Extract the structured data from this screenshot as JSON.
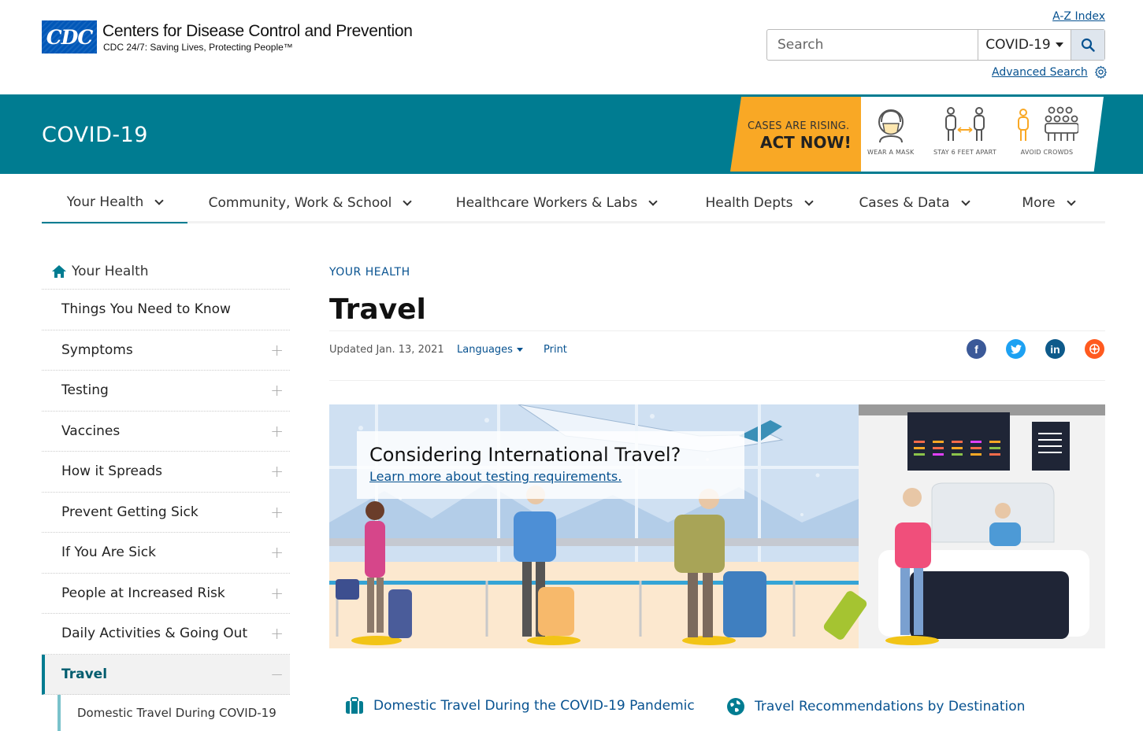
{
  "header": {
    "logo_text": "CDC",
    "org_name": "Centers for Disease Control and Prevention",
    "tagline": "CDC 24/7: Saving Lives, Protecting People™",
    "az_index": "A-Z Index",
    "search_placeholder": "Search",
    "search_scope": "COVID-19",
    "advanced_search": "Advanced Search"
  },
  "banner": {
    "title": "COVID-19",
    "promo_line1": "CASES ARE RISING.",
    "promo_line2": "ACT NOW!",
    "promo_items": [
      "WEAR A MASK",
      "STAY 6 FEET APART",
      "AVOID CROWDS"
    ]
  },
  "nav": {
    "items": [
      "Your Health",
      "Community, Work & School",
      "Healthcare Workers & Labs",
      "Health Depts",
      "Cases & Data",
      "More"
    ]
  },
  "sidebar": {
    "home": "Your Health",
    "items": [
      {
        "label": "Things You Need to Know"
      },
      {
        "label": "Symptoms"
      },
      {
        "label": "Testing"
      },
      {
        "label": "Vaccines"
      },
      {
        "label": "How it Spreads"
      },
      {
        "label": "Prevent Getting Sick"
      },
      {
        "label": "If You Are Sick"
      },
      {
        "label": "People at Increased Risk"
      },
      {
        "label": "Daily Activities & Going Out"
      },
      {
        "label": "Travel"
      }
    ],
    "sub_item": "Domestic Travel During COVID-19"
  },
  "main": {
    "kicker": "YOUR HEALTH",
    "title": "Travel",
    "updated": "Updated Jan. 13, 2021",
    "languages": "Languages",
    "print": "Print",
    "hero_heading": "Considering International Travel?",
    "hero_link": "Learn more about testing requirements.",
    "link1": "Domestic Travel During the COVID-19 Pandemic",
    "link2": "Travel Recommendations by Destination"
  },
  "colors": {
    "brand_teal": "#007c91",
    "link_blue": "#075290",
    "promo_orange": "#f9a825"
  }
}
